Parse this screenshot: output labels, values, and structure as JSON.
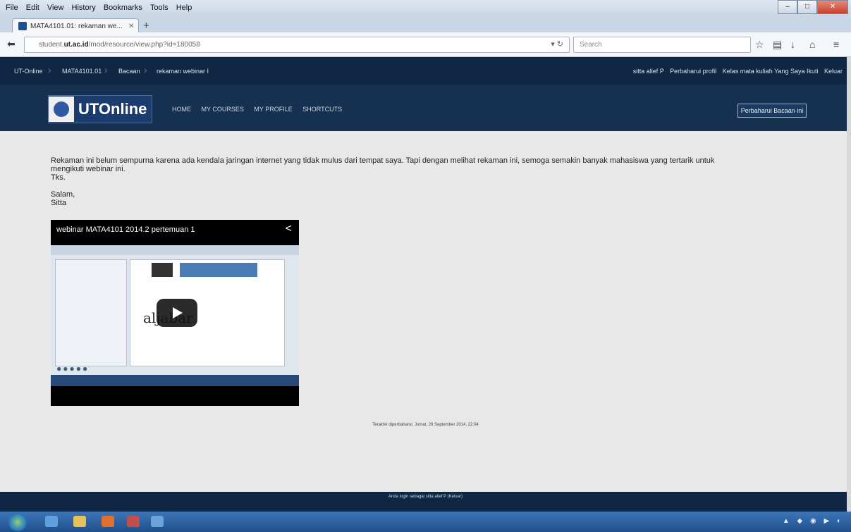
{
  "browser": {
    "menu": [
      "File",
      "Edit",
      "View",
      "History",
      "Bookmarks",
      "Tools",
      "Help"
    ],
    "tab_title": "MATA4101.01: rekaman we...",
    "url_prefix": "student.",
    "url_domain": "ut.ac.id",
    "url_rest": "/mod/resource/view.php?id=180058",
    "search_placeholder": "Search"
  },
  "site": {
    "breadcrumbs": [
      "UT-Online",
      "MATA4101.01",
      "Bacaan",
      "rekaman webinar I"
    ],
    "user_links": [
      "sitta alief P",
      "Perbaharui profil",
      "Kelas mata kuliah Yang Saya Ikuti",
      "Keluar"
    ],
    "logo_text": "UTOnline",
    "nav": [
      "HOME",
      "MY COURSES",
      "MY PROFILE",
      "SHORTCUTS"
    ],
    "turn_editing": "Perbaharui Bacaan ini"
  },
  "content": {
    "line1": "Rekaman ini belum sempurna karena ada kendala jaringan internet yang tidak mulus dari tempat saya. Tapi dengan melihat rekaman ini, semoga semakin banyak mahasiswa yang tertarik untuk",
    "line2": "mengikuti webinar ini.",
    "line3": "Tks.",
    "line4": "Salam,",
    "line5": "Sitta"
  },
  "video": {
    "title": "webinar MATA4101 2014.2 pertemuan 1",
    "board_text": "aljabar"
  },
  "last_modified": "Terakhir diperbaharui: Jumat, 26 September 2014, 22:04",
  "footer_text": "Anda login sebagai sitta alief P (Keluar)"
}
